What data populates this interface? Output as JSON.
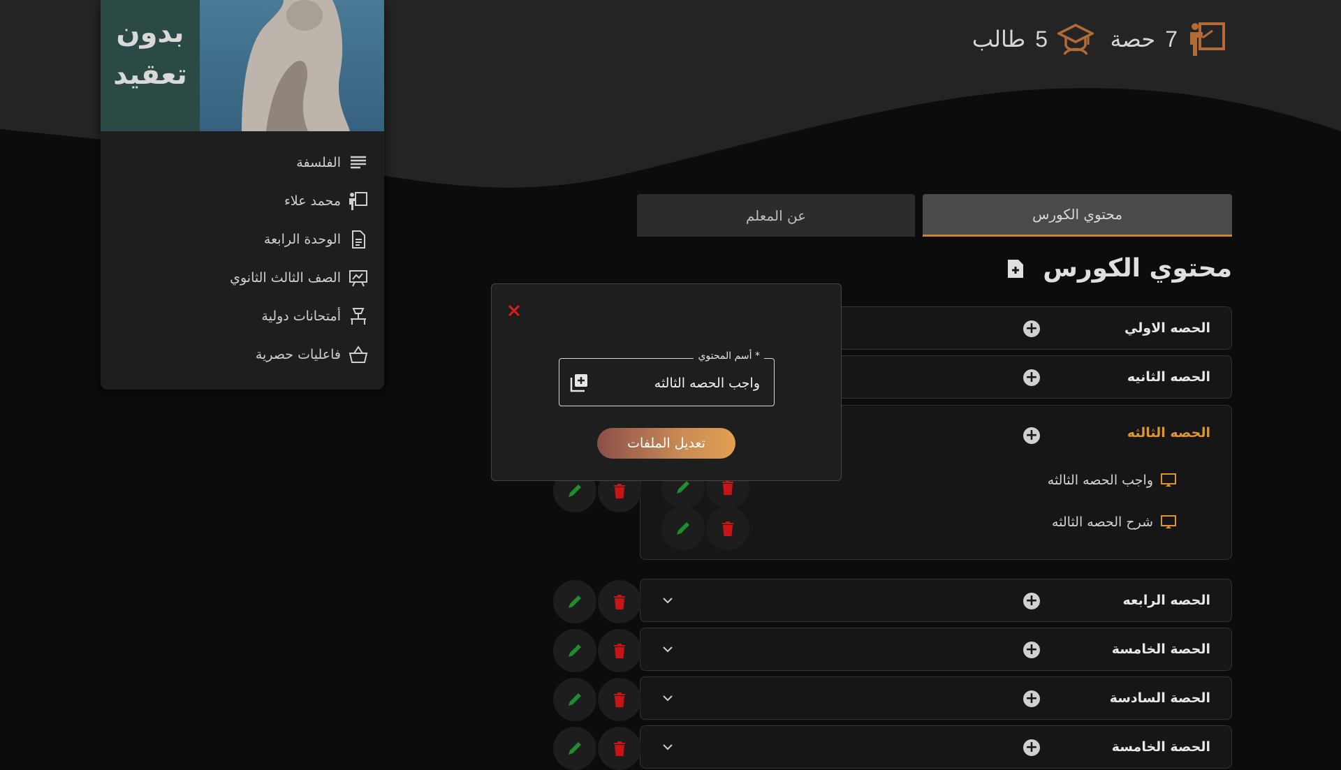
{
  "header": {
    "sessions_count": "7",
    "sessions_label": "حصة",
    "students_count": "5",
    "students_label": "طالب"
  },
  "sidebar": {
    "brand_line1": "بدون",
    "brand_line2": "تعقيد",
    "items": [
      {
        "label": "الفلسفة",
        "icon": "subject-lines-icon"
      },
      {
        "label": "محمد علاء",
        "icon": "teacher-board-icon"
      },
      {
        "label": "الوحدة الرابعة",
        "icon": "document-icon"
      },
      {
        "label": "الصف الثالث الثانوي",
        "icon": "classroom-board-icon"
      },
      {
        "label": "أمتحانات دولية",
        "icon": "exam-icon"
      },
      {
        "label": "فاعليات حصرية",
        "icon": "basket-icon"
      }
    ]
  },
  "tabs": {
    "course_content": "محتوي الكورس",
    "about_teacher": "عن المعلم"
  },
  "section": {
    "title": "محتوي الكورس"
  },
  "lessons": [
    {
      "title": "الحصه الاولي"
    },
    {
      "title": "الحصه الثانيه"
    },
    {
      "title": "الحصه الثالثه",
      "items": [
        "واجب الحصه الثالثه",
        "شرح الحصه الثالثه"
      ]
    },
    {
      "title": "الحصه الرابعه"
    },
    {
      "title": "الحصة الخامسة"
    },
    {
      "title": "الحصة السادسة"
    },
    {
      "title": "الحصة الخامسة"
    }
  ],
  "modal": {
    "field_label": "أسم المحتوي *",
    "field_value": "واجب الحصه الثالثه",
    "submit_label": "تعديل الملفات"
  },
  "colors": {
    "accent": "#e0962f",
    "edit": "#1e8e2e",
    "delete": "#c81414",
    "close": "#e01b1b"
  }
}
